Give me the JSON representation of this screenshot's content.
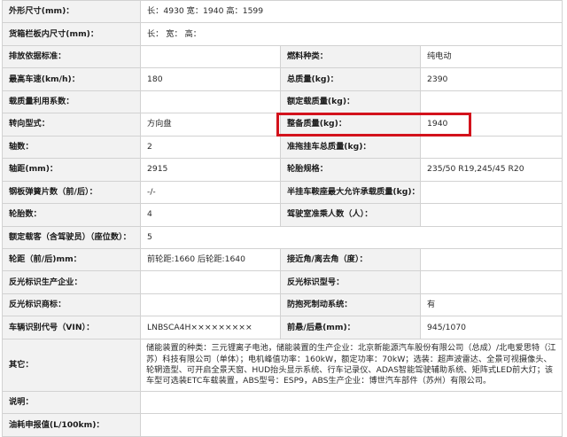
{
  "rows": [
    {
      "l1": "外形尺寸(mm)：",
      "v1": "长：4930 宽：1940 高：1599"
    },
    {
      "l1": "货箱栏板内尺寸(mm)：",
      "v1": "长： 宽： 高："
    },
    {
      "l1": "排放依据标准：",
      "v1": "",
      "l2": "燃料种类：",
      "v2": "纯电动"
    },
    {
      "l1": "最高车速(km/h)：",
      "v1": "180",
      "l2": "总质量(kg)：",
      "v2": "2390"
    },
    {
      "l1": "载质量利用系数：",
      "v1": "",
      "l2": "额定载质量(kg)：",
      "v2": ""
    },
    {
      "l1": "转向型式：",
      "v1": "方向盘",
      "l2": "整备质量(kg)：",
      "v2": "1940"
    },
    {
      "l1": "轴数：",
      "v1": "2",
      "l2": "准拖挂车总质量(kg)：",
      "v2": ""
    },
    {
      "l1": "轴距(mm)：",
      "v1": "2915",
      "l2": "轮胎规格：",
      "v2": "235/50 R19,245/45 R20"
    },
    {
      "l1": "钢板弹簧片数（前/后）：",
      "v1": "-/-",
      "l2": "半挂车鞍座最大允许承载质量(kg)：",
      "v2": ""
    },
    {
      "l1": "轮胎数：",
      "v1": "4",
      "l2": "驾驶室准乘人数（人）：",
      "v2": ""
    },
    {
      "l1": "额定载客（含驾驶员）（座位数）：",
      "v1": "5"
    },
    {
      "l1": "轮距（前/后)mm：",
      "v1": "前轮距:1660 后轮距:1640",
      "l2": "接近角/离去角（度）：",
      "v2": ""
    },
    {
      "l1": "反光标识生产企业：",
      "v1": "",
      "l2": "反光标识型号：",
      "v2": ""
    },
    {
      "l1": "反光标识商标：",
      "v1": "",
      "l2": "防抱死制动系统：",
      "v2": "有"
    },
    {
      "l1": "车辆识别代号（VIN）：",
      "v1": "LNBSCA4H×××××××××",
      "l2": "前悬/后悬(mm)：",
      "v2": "945/1070"
    },
    {
      "l1": "其它：",
      "v1": "储能装置的种类：三元锂离子电池，储能装置的生产企业：北京新能源汽车股份有限公司（总成）/北电爱思特（江苏）科技有限公司（单体）；电机峰值功率：160kW，额定功率：70kW；选装：超声波雷达、全景可视摄像头、轮辋造型、可开启全景天窗、HUD抬头显示系统、行车记录仪、ADAS智能驾驶辅助系统、矩阵式LED前大灯；该车型可选装ETC车载装置，ABS型号：ESP9，ABS生产企业：博世汽车部件（苏州）有限公司。"
    },
    {
      "l1": "说明：",
      "v1": ""
    },
    {
      "l1": "油耗申报值(L/100km)：",
      "v1": ""
    }
  ]
}
